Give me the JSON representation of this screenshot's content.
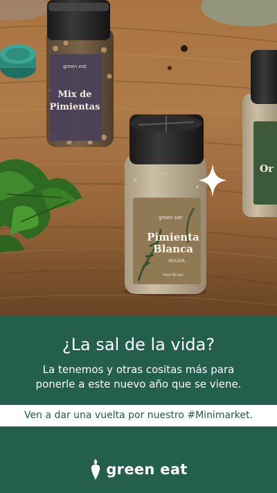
{
  "photo": {
    "left_jar_label": [
      "Mix de",
      "Pimientas"
    ],
    "left_jar_small": "green eat",
    "center_jar_brand": "green eat",
    "center_jar_label": [
      "Pimienta",
      "Blanca"
    ],
    "center_jar_sub": "MOLIDA",
    "center_jar_weight": "Peso 60 grs",
    "right_jar_label": "Or"
  },
  "text": {
    "headline": "¿La sal de la vida?",
    "sub_line1": "La tenemos y otras cositas más para",
    "sub_line2": "ponerle a este nuevo año que se viene.",
    "band": "Ven a dar una vuelta por nuestro #Minimarket."
  },
  "logo": {
    "text": "green eat",
    "icon": "carrot-icon"
  },
  "colors": {
    "primary_green": "#245e4d",
    "band_bg": "#ffffff",
    "band_text": "#1f5a49",
    "text_white": "#ffffff"
  }
}
